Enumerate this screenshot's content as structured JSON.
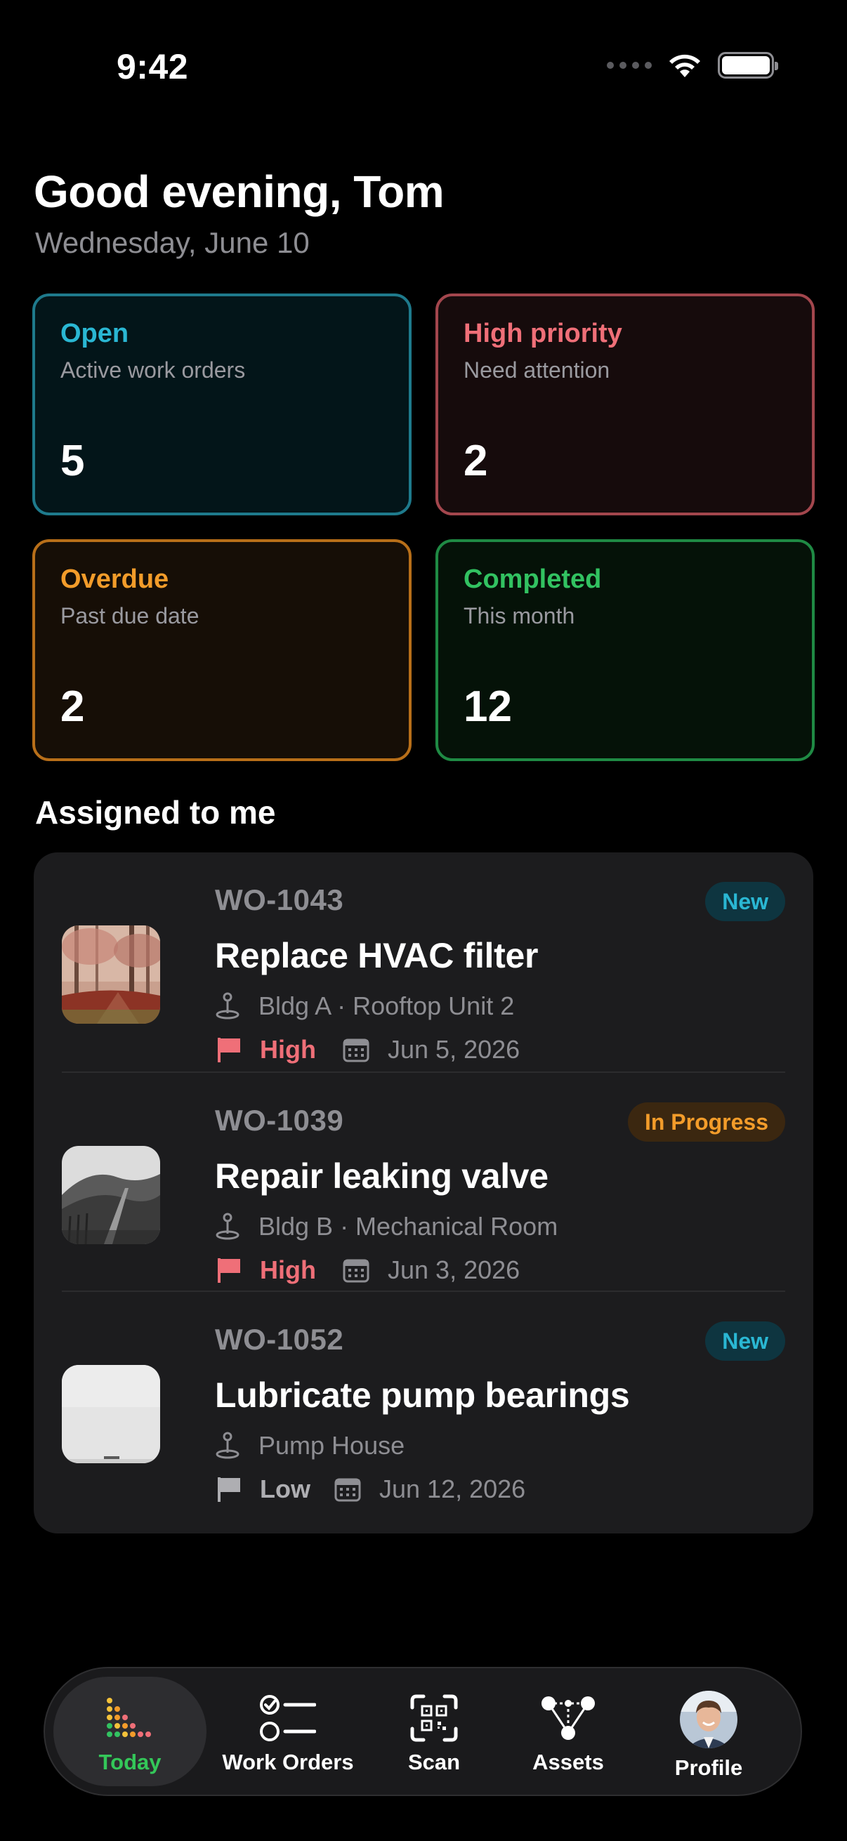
{
  "status_bar": {
    "time": "9:42"
  },
  "header": {
    "greeting": "Good evening, Tom",
    "date": "Wednesday, June 10"
  },
  "stats": [
    {
      "title": "Open",
      "subtitle": "Active work orders",
      "value": "5",
      "color": "#2ab7d3"
    },
    {
      "title": "High priority",
      "subtitle": "Need attention",
      "value": "2",
      "color": "#ef6f78"
    },
    {
      "title": "Overdue",
      "subtitle": "Past due date",
      "value": "2",
      "color": "#f39c2a"
    },
    {
      "title": "Completed",
      "subtitle": "This month",
      "value": "12",
      "color": "#32c261"
    }
  ],
  "section": {
    "title": "Assigned to me"
  },
  "work_orders": [
    {
      "id": "WO-1043",
      "status": "New",
      "title": "Replace HVAC filter",
      "location": "Bldg A · Rooftop Unit 2",
      "priority": "High",
      "due": "Jun 5, 2026",
      "thumb_icon": "autumn-forest-thumbnail"
    },
    {
      "id": "WO-1039",
      "status": "In Progress",
      "title": "Repair leaking valve",
      "location": "Bldg B · Mechanical Room",
      "priority": "High",
      "due": "Jun 3, 2026",
      "thumb_icon": "hillside-fence-thumbnail"
    },
    {
      "id": "WO-1052",
      "status": "New",
      "title": "Lubricate pump bearings",
      "location": "Pump House",
      "priority": "Low",
      "due": "Jun 12, 2026",
      "thumb_icon": "foggy-sky-thumbnail"
    }
  ],
  "tabbar": {
    "items": [
      {
        "label": "Today",
        "icon": "today-icon",
        "active": true
      },
      {
        "label": "Work Orders",
        "icon": "checklist-icon"
      },
      {
        "label": "Scan",
        "icon": "qr-scan-icon"
      },
      {
        "label": "Assets",
        "icon": "assets-graph-icon"
      },
      {
        "label": "Profile",
        "icon": "avatar"
      }
    ]
  }
}
